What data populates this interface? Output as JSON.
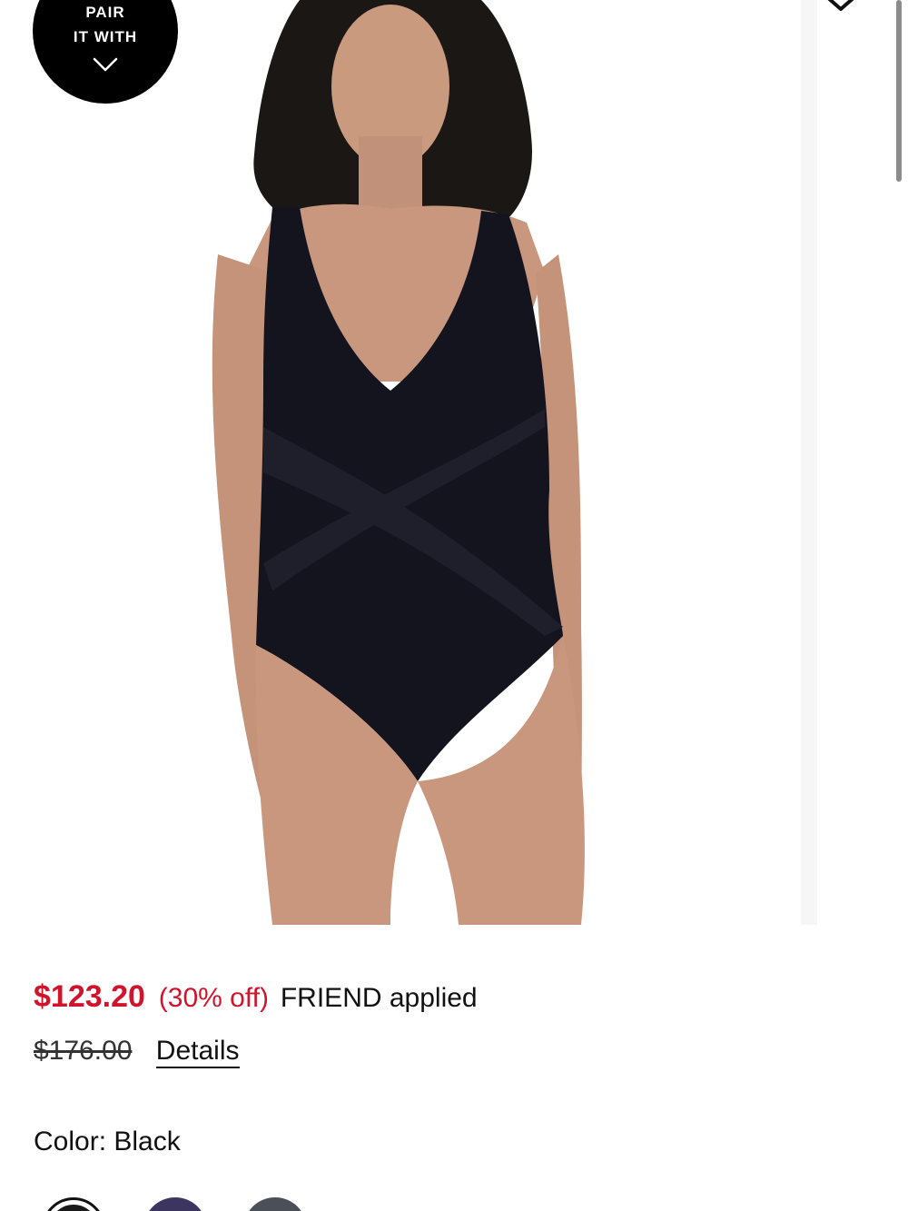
{
  "pair_badge": {
    "line1": "PAIR",
    "line2": "IT WITH",
    "icon": "chevron-down-icon"
  },
  "product_image": {
    "icon": "product-photo",
    "next_icon": "heart-icon"
  },
  "price": {
    "sale": "$123.20",
    "discount": "(30% off)",
    "promo": "FRIEND applied",
    "original": "$176.00",
    "details_label": "Details",
    "sale_color": "#d0142c"
  },
  "color": {
    "label": "Color: Black",
    "swatches": [
      {
        "name": "Black",
        "hex": "#1a1a1a",
        "selected": true
      },
      {
        "name": "swatch-2",
        "hex": "#3b3560",
        "selected": false
      },
      {
        "name": "swatch-3",
        "hex": "#4a4f58",
        "selected": false
      }
    ]
  }
}
